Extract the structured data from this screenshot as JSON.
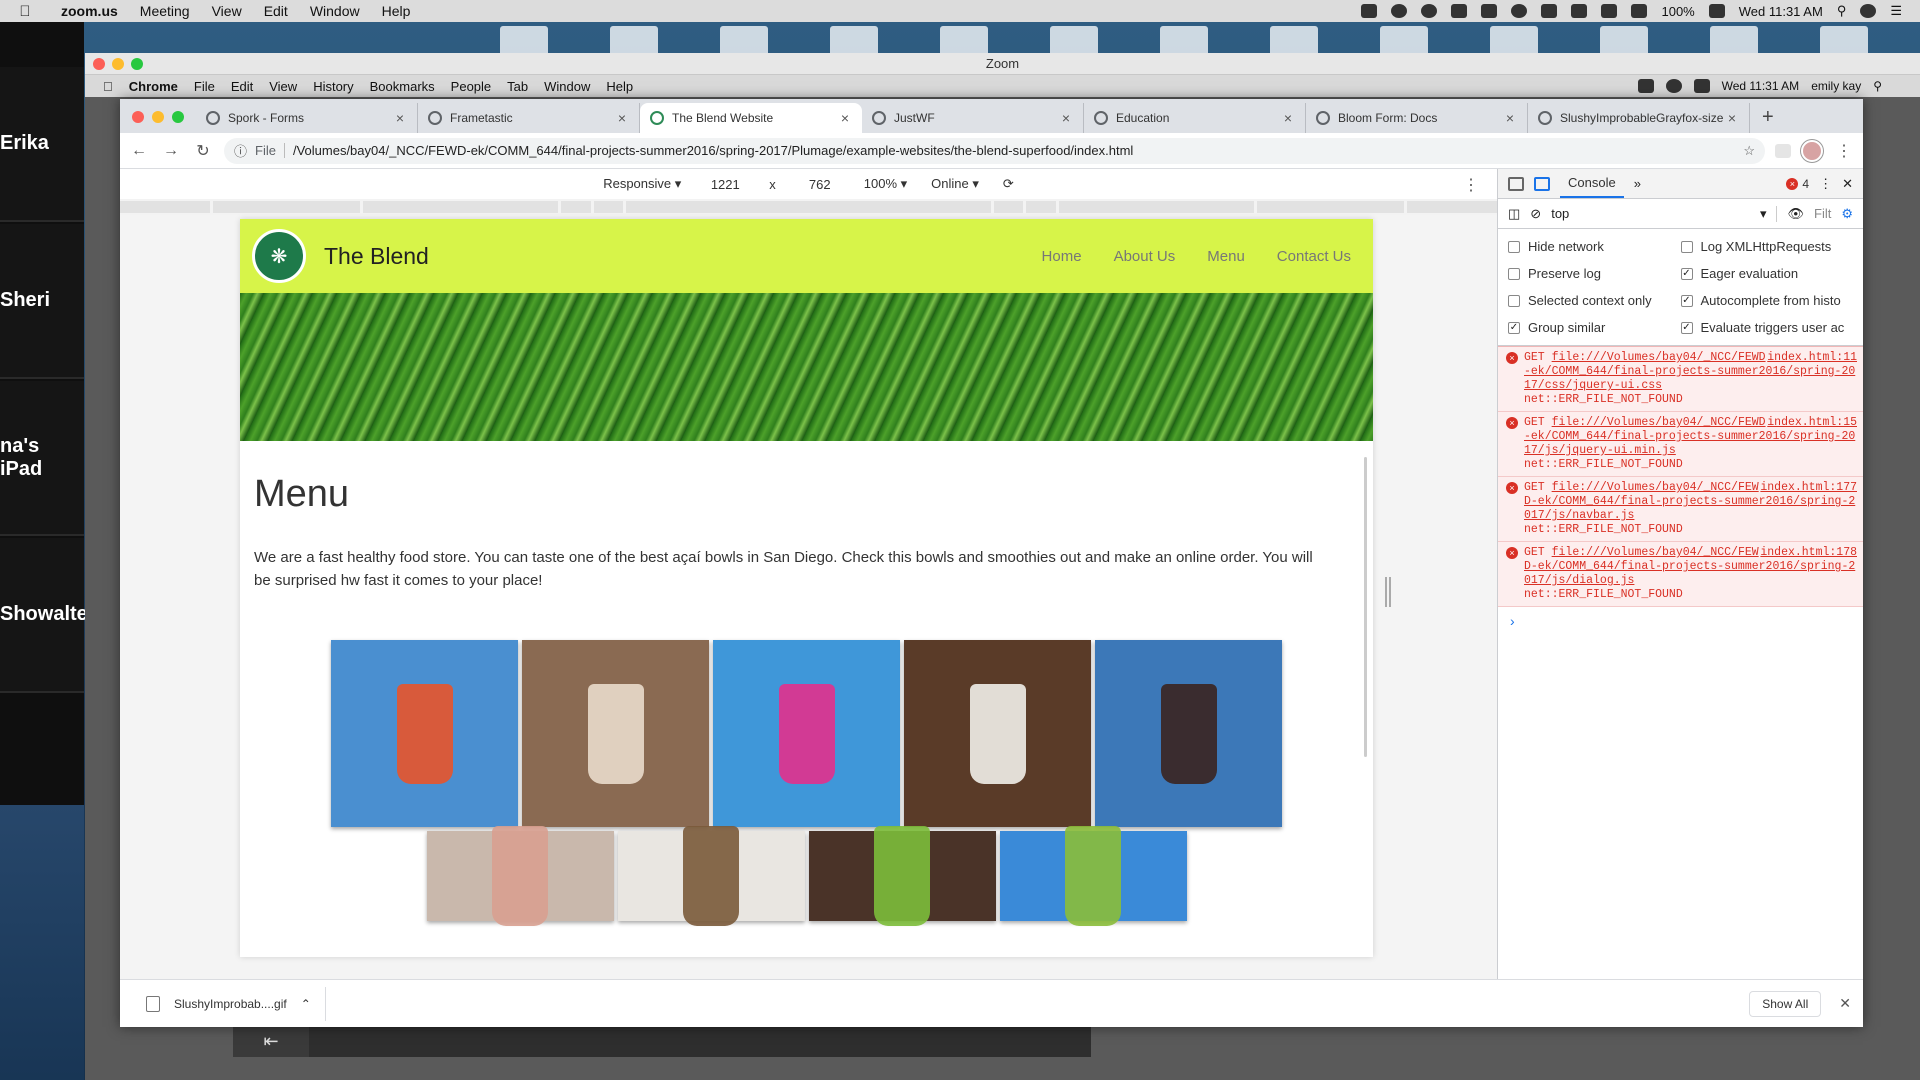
{
  "mac_menu": {
    "app": "zoom.us",
    "items": [
      "Meeting",
      "View",
      "Edit",
      "Window",
      "Help"
    ],
    "battery": "100%",
    "clock": "Wed 11:31 AM"
  },
  "zoom": {
    "window_title": "Zoom",
    "participants": [
      "Erika",
      "Sheri",
      "na's iPad",
      "Showalte"
    ]
  },
  "chrome_menu": {
    "app": "Chrome",
    "items": [
      "File",
      "Edit",
      "View",
      "History",
      "Bookmarks",
      "People",
      "Tab",
      "Window",
      "Help"
    ],
    "clock": "Wed 11:31 AM",
    "user": "emily kay"
  },
  "tabs": [
    {
      "title": "Spork - Forms"
    },
    {
      "title": "Frametastic"
    },
    {
      "title": "The Blend Website"
    },
    {
      "title": "JustWF"
    },
    {
      "title": "Education"
    },
    {
      "title": "Bloom Form: Docs"
    },
    {
      "title": "SlushyImprobableGrayfox-size"
    }
  ],
  "omnibox": {
    "scheme_label": "File",
    "url": "/Volumes/bay04/_NCC/FEWD-ek/COMM_644/final-projects-summer2016/spring-2017/Plumage/example-websites/the-blend-superfood/index.html"
  },
  "device_toolbar": {
    "mode": "Responsive",
    "width": "1221",
    "x": "x",
    "height": "762",
    "zoom": "100%",
    "throttle": "Online"
  },
  "site": {
    "brand": "The Blend",
    "nav": [
      "Home",
      "About Us",
      "Menu",
      "Contact Us"
    ],
    "heading": "Menu",
    "intro": "We are a fast healthy food store. You can taste one of the best açaí bowls in San Diego. Check this bowls and smoothies out and make an online order. You will be surprised hw fast it comes to your place!",
    "photos": [
      {
        "bg": "#4a8fd0",
        "cup": "#e8542a"
      },
      {
        "bg": "#8a6a52",
        "cup": "#e9dccb"
      },
      {
        "bg": "#3f97d9",
        "cup": "#e2308c"
      },
      {
        "bg": "#5a3b28",
        "cup": "#f1efe9"
      },
      {
        "bg": "#3c78b8",
        "cup": "#3a2420"
      },
      {
        "bg": "#c9b8ac",
        "cup": "#d8a090"
      },
      {
        "bg": "#e9e6e1",
        "cup": "#7a5a3a"
      },
      {
        "bg": "#4a3328",
        "cup": "#7cbd3a"
      },
      {
        "bg": "#3a8ad8",
        "cup": "#8bbd3a"
      }
    ]
  },
  "devtools": {
    "tab": "Console",
    "more": "»",
    "error_count": "4",
    "context": "top",
    "filter_label": "Filt",
    "settings": [
      {
        "label": "Hide network",
        "checked": false
      },
      {
        "label": "Log XMLHttpRequests",
        "checked": false
      },
      {
        "label": "Preserve log",
        "checked": false
      },
      {
        "label": "Eager evaluation",
        "checked": true
      },
      {
        "label": "Selected context only",
        "checked": false
      },
      {
        "label": "Autocomplete from histo",
        "checked": true
      },
      {
        "label": "Group similar",
        "checked": true
      },
      {
        "label": "Evaluate triggers user ac",
        "checked": true
      }
    ],
    "errors": [
      {
        "method": "GET",
        "path": "file:///Volumes/bay04/_NCC/FEWD-ek/COMM_644/final-projects-summer2016/spring-2017/css/jquery-ui.css",
        "source": "index.html:11",
        "message": "net::ERR_FILE_NOT_FOUND"
      },
      {
        "method": "GET",
        "path": "file:///Volumes/bay04/_NCC/FEWD-ek/COMM_644/final-projects-summer2016/spring-2017/js/jquery-ui.min.js",
        "source": "index.html:15",
        "message": "net::ERR_FILE_NOT_FOUND"
      },
      {
        "method": "GET",
        "path": "file:///Volumes/bay04/_NCC/FEWD-ek/COMM_644/final-projects-summer2016/spring-2017/js/navbar.js",
        "source": "index.html:177",
        "message": "net::ERR_FILE_NOT_FOUND"
      },
      {
        "method": "GET",
        "path": "file:///Volumes/bay04/_NCC/FEWD-ek/COMM_644/final-projects-summer2016/spring-2017/js/dialog.js",
        "source": "index.html:178",
        "message": "net::ERR_FILE_NOT_FOUND"
      }
    ],
    "prompt": "›"
  },
  "download": {
    "file": "SlushyImprobab....gif",
    "show_all": "Show All"
  },
  "colors": {
    "site_nav": "#d7f449",
    "error_red": "#d93025",
    "accent_blue": "#1a73e8"
  }
}
